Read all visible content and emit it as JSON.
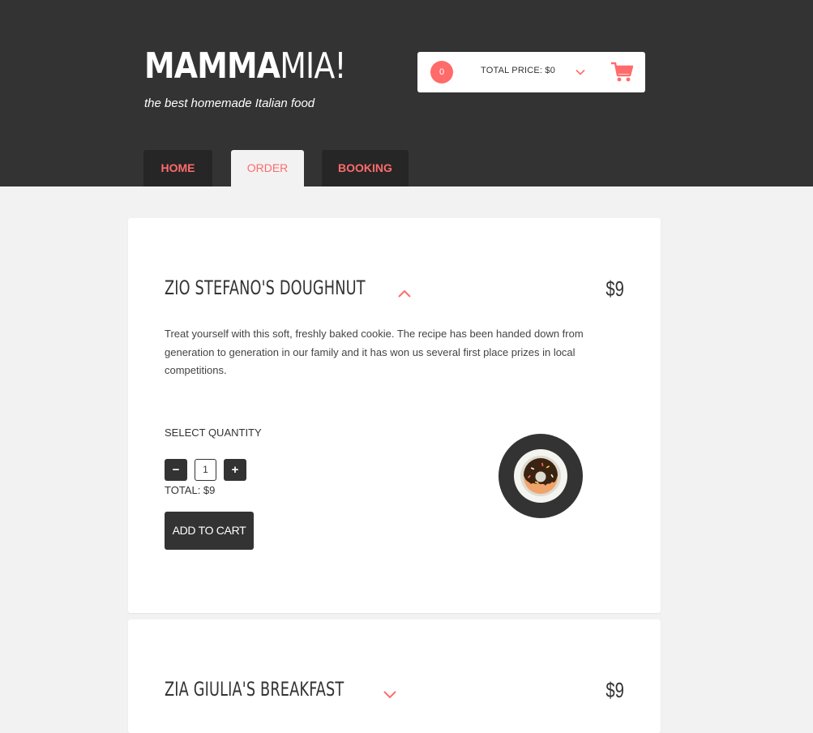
{
  "header": {
    "logo_bold": "MAMMA",
    "logo_light": "MIA!",
    "tagline": "the best homemade Italian food"
  },
  "cart": {
    "count": "0",
    "total_label": "TOTAL PRICE: $0"
  },
  "nav": {
    "tabs": [
      {
        "label": "HOME"
      },
      {
        "label": "ORDER"
      },
      {
        "label": "BOOKING"
      }
    ]
  },
  "products": [
    {
      "title": "ZIO STEFANO'S DOUGHNUT",
      "price": "$9",
      "description": "Treat yourself with this soft, freshly baked cookie. The recipe has been handed down from generation to generation in our family and it has won us several first place prizes in local competitions.",
      "quantity_label": "SELECT QUANTITY",
      "minus_label": "−",
      "quantity": "1",
      "plus_label": "+",
      "total": "TOTAL: $9",
      "add_label": "ADD TO CART"
    },
    {
      "title": "ZIA GIULIA'S BREAKFAST",
      "price": "$9"
    }
  ],
  "colors": {
    "accent": "#ff6b6b",
    "header_bg": "#333333",
    "tab_bg": "#262626",
    "page_bg": "#f2f2f2"
  },
  "icons": {
    "cart": "shopping-cart-icon",
    "expand": "chevron-down-icon",
    "collapse": "chevron-up-icon",
    "dish": "doughnut-plate-image"
  }
}
